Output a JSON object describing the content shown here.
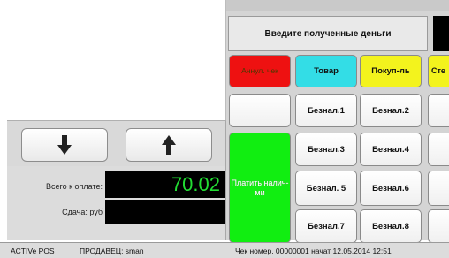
{
  "prompt": "Введите полученные деньги",
  "buttons": {
    "annul": "Аннул. чек",
    "goods": "Товар",
    "buyer": "Покуп-ль",
    "partial": "Сте",
    "cashless1": "Безнал.1",
    "cashless2": "Безнал.2",
    "cashless3": "Безнал.3",
    "cashless4": "Безнал.4",
    "cashless5": "Безнал. 5",
    "cashless6": "Безнал.6",
    "cashless7": "Безнал.7",
    "cashless8": "Безнал.8",
    "pay_cash": "Платить налич-ми"
  },
  "totals": {
    "due_label": "Всего к оплате:",
    "due_value": "70.02",
    "change_label": "Сдача: руб",
    "change_value": ""
  },
  "status": {
    "app": "ACTIVe POS",
    "seller": "ПРОДАВЕЦ: sman",
    "check": "Чек номер. 00000001 начат 12.05.2014 12:51"
  },
  "icons": {
    "down": "arrow-down-icon",
    "up": "arrow-up-icon"
  },
  "colors": {
    "annul": "#ee1111",
    "goods": "#33dde6",
    "buyer": "#f3f31d",
    "pay_cash": "#11ee11",
    "display_bg": "#000000",
    "display_text": "#22dd33"
  }
}
